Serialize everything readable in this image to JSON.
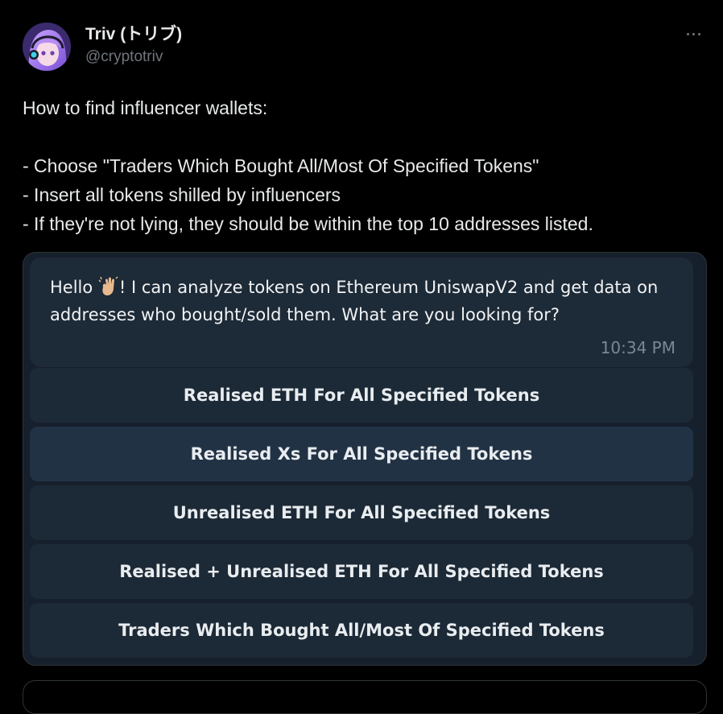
{
  "author": {
    "display_name": "Triv (トリブ)",
    "handle": "@cryptotriv"
  },
  "tweet": {
    "lines": [
      "How to find influencer wallets:",
      "",
      "- Choose \"Traders Which Bought All/Most Of Specified Tokens\"",
      "- Insert all tokens shilled by influencers",
      "- If they're not lying, they should be within the top 10 addresses listed."
    ]
  },
  "media": {
    "message_before": "Hello ",
    "message_after": "! I can analyze tokens on Ethereum UniswapV2 and get data on addresses who bought/sold them. What are you looking for?",
    "time": "10:34 PM",
    "buttons": [
      "Realised ETH For All Specified Tokens",
      "Realised Xs For All Specified Tokens",
      "Unrealised ETH For All Specified Tokens",
      "Realised + Unrealised ETH For All Specified Tokens",
      "Traders Which Bought All/Most Of Specified Tokens"
    ]
  },
  "icons": {
    "more": "more-horizontal-icon",
    "wave": "waving-hand-emoji"
  },
  "colors": {
    "background": "#000000",
    "text": "#e7e9ea",
    "muted": "#71767b",
    "chat_bg": "#16202c",
    "bubble_bg": "#1d2a37",
    "button_bg": "#1c2936"
  }
}
